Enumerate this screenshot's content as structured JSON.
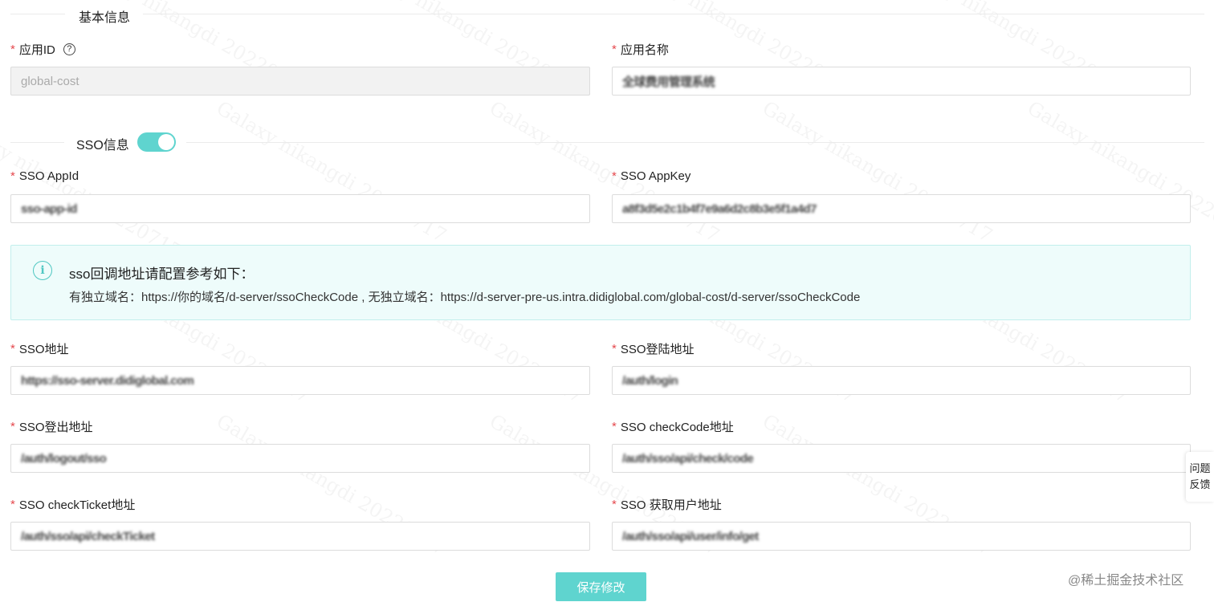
{
  "watermark_text": "Galaxy nikangdi 20220717",
  "section_basic": {
    "title": "基本信息"
  },
  "fields": {
    "app_id": {
      "label": "应用ID",
      "help_icon": "question-circle-icon",
      "value": "global-cost"
    },
    "app_name": {
      "label": "应用名称",
      "value": "全球费用管理系统"
    },
    "sso_app_id": {
      "label": "SSO AppId",
      "value": "sso-app-id"
    },
    "sso_app_key": {
      "label": "SSO AppKey",
      "value": "a8f3d5e2c1b4f7e9a6d2c8b3e5f1a4d7"
    },
    "sso_url": {
      "label": "SSO地址",
      "value": "https://sso-server.didiglobal.com"
    },
    "sso_login_url": {
      "label": "SSO登陆地址",
      "value": "/auth/login"
    },
    "sso_logout_url": {
      "label": "SSO登出地址",
      "value": "/auth/logout/sso"
    },
    "sso_checkcode_url": {
      "label": "SSO checkCode地址",
      "value": "/auth/sso/api/check/code"
    },
    "sso_checkticket_url": {
      "label": "SSO checkTicket地址",
      "value": "/auth/sso/api/checkTicket"
    },
    "sso_user_url": {
      "label": "SSO 获取用户地址",
      "value": "/auth/sso/api/user/info/get"
    }
  },
  "section_sso": {
    "title": "SSO信息",
    "toggle_on": true
  },
  "info": {
    "icon": "info-circle-icon",
    "title": "sso回调地址请配置参考如下：",
    "text": "有独立域名：https://你的域名/d-server/ssoCheckCode , 无独立域名：https://d-server-pre-us.intra.didiglobal.com/global-cost/d-server/ssoCheckCode"
  },
  "save_button": "保存修改",
  "feedback": {
    "line1": "问题",
    "line2": "反馈"
  },
  "footer_credit": "@稀土掘金技术社区",
  "colors": {
    "accent": "#5fd4cf",
    "required": "#e5484d",
    "info_bg": "#eefcfb"
  }
}
